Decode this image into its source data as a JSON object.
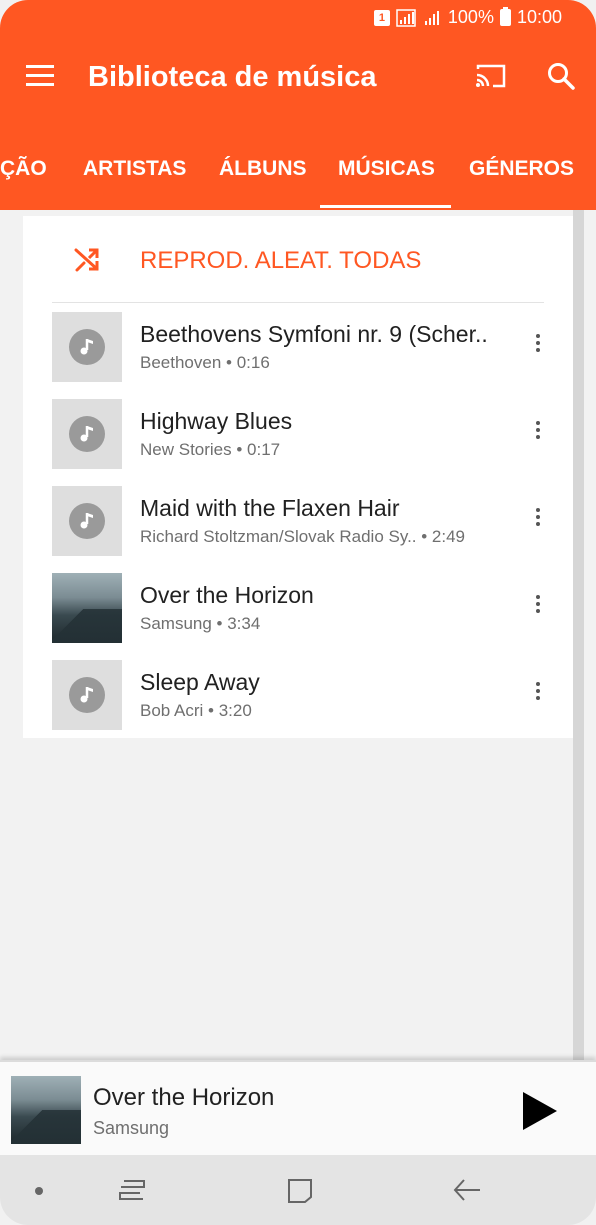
{
  "status_bar": {
    "sim": "1",
    "battery_pct": "100%",
    "time": "10:00"
  },
  "app_bar": {
    "title": "Biblioteca de música"
  },
  "tabs": [
    {
      "label": "ÇÃO"
    },
    {
      "label": "ARTISTAS"
    },
    {
      "label": "ÁLBUNS"
    },
    {
      "label": "MÚSICAS",
      "selected": true
    },
    {
      "label": "GÉNEROS"
    }
  ],
  "shuffle": {
    "label": "REPROD. ALEAT. TODAS"
  },
  "songs": [
    {
      "title": "Beethovens Symfoni nr. 9 (Scher..",
      "subtitle": "Beethoven • 0:16",
      "artwork": "music-note-icon"
    },
    {
      "title": "Highway Blues",
      "subtitle": "New Stories • 0:17",
      "artwork": "music-note-icon"
    },
    {
      "title": "Maid with the Flaxen Hair",
      "subtitle": "Richard Stoltzman/Slovak Radio Sy..  • 2:49",
      "artwork": "music-note-icon"
    },
    {
      "title": "Over the Horizon",
      "subtitle": "Samsung • 3:34",
      "artwork": "album-art"
    },
    {
      "title": "Sleep Away",
      "subtitle": "Bob Acri • 3:20",
      "artwork": "music-note-icon"
    }
  ],
  "mini_player": {
    "title": "Over the Horizon",
    "artist": "Samsung"
  },
  "colors": {
    "accent": "#ff5722",
    "text_primary": "#212121",
    "text_secondary": "#6f6f6f"
  }
}
